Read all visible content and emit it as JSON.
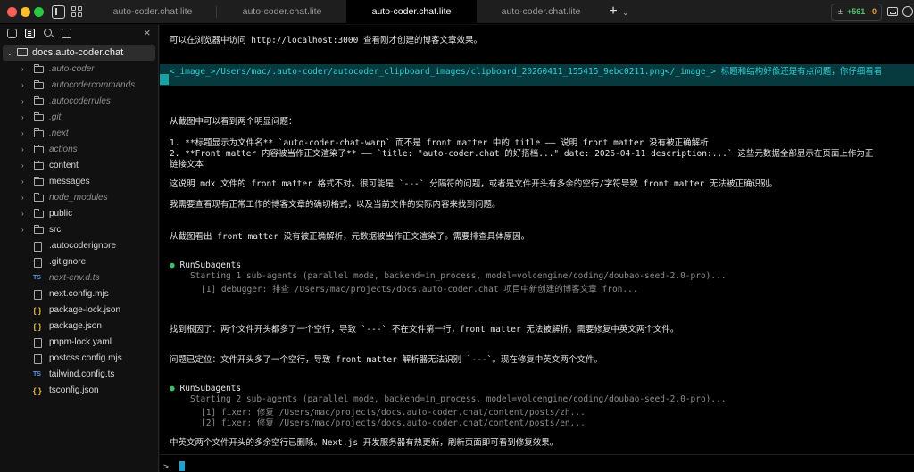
{
  "tabs": [
    {
      "label": "auto-coder.chat.lite",
      "active": false
    },
    {
      "label": "auto-coder.chat.lite",
      "active": false
    },
    {
      "label": "auto-coder.chat.lite",
      "active": true
    },
    {
      "label": "auto-coder.chat.lite",
      "active": false
    }
  ],
  "topbar": {
    "plus": "+",
    "menu_chevron": "⌄",
    "diff_icon": "±",
    "diff_added": "+561",
    "diff_removed": "-0"
  },
  "sidebar": {
    "close": "×",
    "root": {
      "chevron": "⌄",
      "label": "docs.auto-coder.chat"
    },
    "items": [
      {
        "label": ".auto-coder",
        "type": "folder",
        "ignored": true
      },
      {
        "label": ".autocodercommands",
        "type": "folder",
        "ignored": true
      },
      {
        "label": ".autocoderrules",
        "type": "folder",
        "ignored": true
      },
      {
        "label": ".git",
        "type": "folder",
        "ignored": true
      },
      {
        "label": ".next",
        "type": "folder",
        "ignored": true
      },
      {
        "label": "actions",
        "type": "folder",
        "ignored": true
      },
      {
        "label": "content",
        "type": "folder",
        "ignored": false
      },
      {
        "label": "messages",
        "type": "folder",
        "ignored": false
      },
      {
        "label": "node_modules",
        "type": "folder",
        "ignored": true
      },
      {
        "label": "public",
        "type": "folder",
        "ignored": false
      },
      {
        "label": "src",
        "type": "folder",
        "ignored": false
      },
      {
        "label": ".autocoderignore",
        "type": "file",
        "ignored": false
      },
      {
        "label": ".gitignore",
        "type": "file",
        "ignored": false
      },
      {
        "label": "next-env.d.ts",
        "type": "ts",
        "ignored": true
      },
      {
        "label": "next.config.mjs",
        "type": "file",
        "ignored": false
      },
      {
        "label": "package-lock.json",
        "type": "json",
        "ignored": false
      },
      {
        "label": "package.json",
        "type": "json",
        "ignored": false
      },
      {
        "label": "pnpm-lock.yaml",
        "type": "file",
        "ignored": false
      },
      {
        "label": "postcss.config.mjs",
        "type": "file",
        "ignored": false
      },
      {
        "label": "tailwind.config.ts",
        "type": "ts",
        "ignored": false
      },
      {
        "label": "tsconfig.json",
        "type": "json",
        "ignored": false
      }
    ]
  },
  "terminal": {
    "line_visit": "可以在浏览器中访问 http://localhost:3000 查看刚才创建的博客文章效果。",
    "highlight": "<_image_>/Users/mac/.auto-coder/autocoder_clipboard_images/clipboard_20260411_155415_9ebc0211.png</_image_> 标题和结构好像还是有点问题，你仔细看看",
    "line_problems": "从截图中可以看到两个明显问题：",
    "line_p1": "1. **标题显示为文件名** `auto-coder-chat-warp` 而不是 front matter 中的 title —— 说明 front matter 没有被正确解析",
    "line_p2": "2. **Front matter 内容被当作正文渲染了** —— `title: \"auto-coder.chat 的好搭档...\" date: 2026-04-11 description:...` 这些元数据全部显示在页面上作为正",
    "line_p2b": "链接文本",
    "line_explain": "这说明 mdx 文件的 front matter 格式不对。很可能是 `---` 分隔符的问题，或者是文件开头有多余的空行/字符导致 front matter 无法被正确识别。",
    "line_check": "我需要查看现有正常工作的博客文章的确切格式，以及当前文件的实际内容来找到问题。",
    "line_screenshot": "从截图看出 front matter 没有被正确解析，元数据被当作正文渲染了。需要排查具体原因。",
    "run1_title": "RunSubagents",
    "run1_start": "Starting 1 sub-agents (parallel mode, backend=in_process, model=volcengine/coding/doubao-seed-2.0-pro)...",
    "run1_a1": "[1] debugger: 排查 /Users/mac/projects/docs.auto-coder.chat 项目中新创建的博客文章 fron...",
    "line_root": "找到根因了：两个文件开头都多了一个空行，导致 `---` 不在文件第一行，front matter 无法被解析。需要修复中英文两个文件。",
    "line_located": "问题已定位：文件开头多了一个空行，导致 front matter 解析器无法识别 `---`。现在修复中英文两个文件。",
    "run2_title": "RunSubagents",
    "run2_start": "Starting 2 sub-agents (parallel mode, backend=in_process, model=volcengine/coding/doubao-seed-2.0-pro)...",
    "run2_a1": "[1] fixer: 修复 /Users/mac/projects/docs.auto-coder.chat/content/posts/zh...",
    "run2_a2": "[2] fixer: 修复 /Users/mac/projects/docs.auto-coder.chat/content/posts/en...",
    "line_done": "中英文两个文件开头的多余空行已删除。Next.js 开发服务器有热更新，刷新页面即可看到修复效果。",
    "bullet": "●",
    "prompt": ">"
  }
}
